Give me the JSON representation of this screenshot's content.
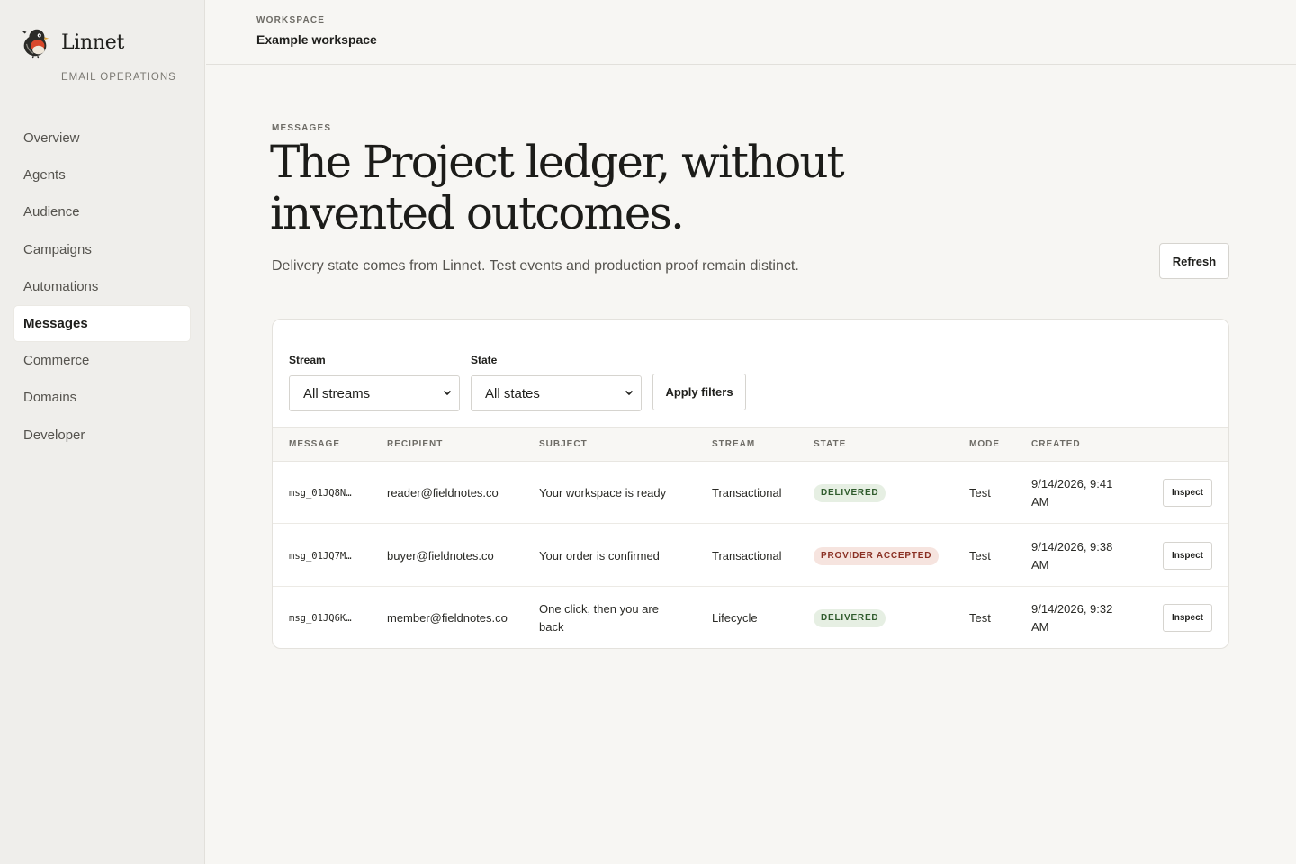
{
  "brand": {
    "name": "Linnet",
    "tagline": "EMAIL OPERATIONS"
  },
  "nav": [
    {
      "label": "Overview",
      "active": false
    },
    {
      "label": "Agents",
      "active": false
    },
    {
      "label": "Audience",
      "active": false
    },
    {
      "label": "Campaigns",
      "active": false
    },
    {
      "label": "Automations",
      "active": false
    },
    {
      "label": "Messages",
      "active": true
    },
    {
      "label": "Commerce",
      "active": false
    },
    {
      "label": "Domains",
      "active": false
    },
    {
      "label": "Developer",
      "active": false
    }
  ],
  "workspace": {
    "label": "WORKSPACE",
    "name": "Example workspace"
  },
  "page": {
    "eyebrow": "MESSAGES",
    "headline": "The Project ledger, without invented outcomes.",
    "subline": "Delivery state comes from Linnet. Test events and production proof remain distinct.",
    "refresh_label": "Refresh"
  },
  "filters": {
    "stream_label": "Stream",
    "stream_value": "All streams",
    "state_label": "State",
    "state_value": "All states",
    "apply_label": "Apply filters"
  },
  "table": {
    "columns": {
      "message": "MESSAGE",
      "recipient": "RECIPIENT",
      "subject": "SUBJECT",
      "stream": "STREAM",
      "state": "STATE",
      "mode": "MODE",
      "created": "CREATED"
    },
    "action_label": "Inspect",
    "rows": [
      {
        "id": "msg_01JQ8N…",
        "recipient": "reader@fieldnotes.co",
        "subject": "Your workspace is ready",
        "stream": "Transactional",
        "state": "DELIVERED",
        "state_kind": "ok",
        "mode": "Test",
        "created": "9/14/2026, 9:41 AM"
      },
      {
        "id": "msg_01JQ7M…",
        "recipient": "buyer@fieldnotes.co",
        "subject": "Your order is confirmed",
        "stream": "Transactional",
        "state": "PROVIDER ACCEPTED",
        "state_kind": "warn",
        "mode": "Test",
        "created": "9/14/2026, 9:38 AM"
      },
      {
        "id": "msg_01JQ6K…",
        "recipient": "member@fieldnotes.co",
        "subject": "One click, then you are back",
        "stream": "Lifecycle",
        "state": "DELIVERED",
        "state_kind": "ok",
        "mode": "Test",
        "created": "9/14/2026, 9:32 AM"
      }
    ]
  },
  "colors": {
    "accent_ok_bg": "#e6efe3",
    "accent_ok_text": "#2f5b2c",
    "accent_warn_bg": "#f6e4df",
    "accent_warn_text": "#8a3024",
    "logo_red": "#d9482b"
  },
  "icons": {
    "logo": "linnet-bird-icon",
    "select_chevron": "chevron-down-icon"
  }
}
